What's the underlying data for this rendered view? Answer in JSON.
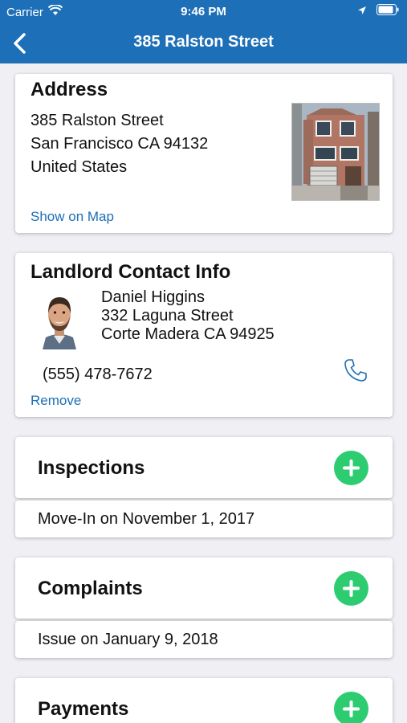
{
  "status_bar": {
    "carrier": "Carrier",
    "time": "9:46 PM"
  },
  "nav": {
    "title": "385 Ralston Street"
  },
  "address": {
    "heading": "Address",
    "line1": "385 Ralston Street",
    "line2": "San Francisco CA 94132",
    "line3": "United States",
    "map_link": "Show on Map"
  },
  "landlord": {
    "heading": "Landlord Contact Info",
    "name": "Daniel Higgins",
    "street": "332 Laguna Street",
    "city": "Corte Madera CA 94925",
    "phone": "(555) 478-7672",
    "remove_link": "Remove"
  },
  "sections": [
    {
      "title": "Inspections",
      "rows": [
        "Move-In on November 1, 2017"
      ]
    },
    {
      "title": "Complaints",
      "rows": [
        "Issue on January 9, 2018"
      ]
    },
    {
      "title": "Payments",
      "rows": []
    }
  ],
  "colors": {
    "accent": "#1d6fb7",
    "add_button": "#2ecc71"
  },
  "icons": [
    "back-chevron-icon",
    "wifi-icon",
    "location-arrow-icon",
    "battery-icon",
    "phone-icon",
    "plus-icon"
  ]
}
